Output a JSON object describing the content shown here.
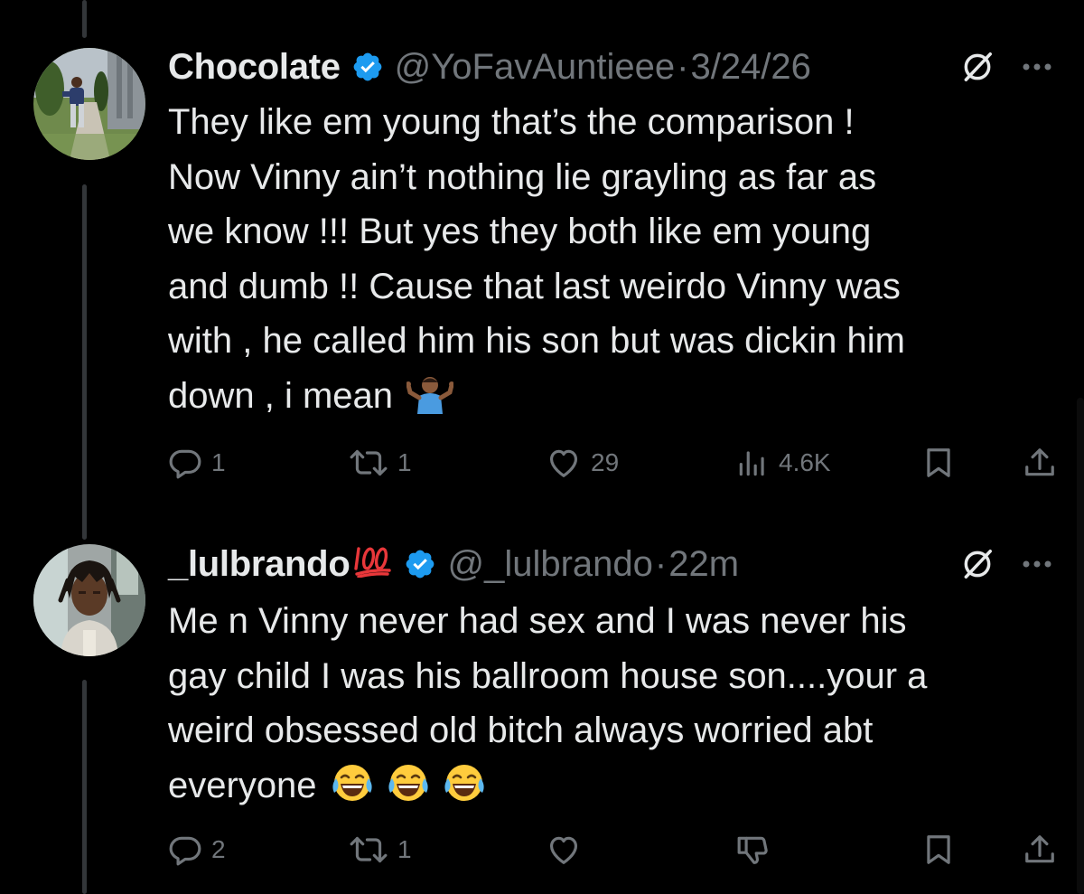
{
  "colors": {
    "background": "#000000",
    "text": "#e7e9ea",
    "muted": "#71767b",
    "verified": "#1d9bf0",
    "thread_line": "#333639"
  },
  "tweets": [
    {
      "display_name": "Chocolate",
      "handle": "@YoFavAuntieee",
      "separator": "·",
      "time": "3/24/26",
      "verified": true,
      "avatar_icon": "avatar-person-outdoors",
      "lines": [
        "They like em young that’s the comparison !",
        "Now Vinny ain’t nothing lie grayling as far as",
        "we know !!! But yes they both like em young",
        "and dumb !! Cause that last weirdo Vinny was",
        "with , he called him his son but was dickin him",
        "down , i mean"
      ],
      "trailing_emoji": "🤷🏾‍♂️",
      "stats": {
        "replies": "1",
        "reposts": "1",
        "likes": "29",
        "views": "4.6K"
      }
    },
    {
      "display_name": "_lulbrando",
      "name_emoji": "💯",
      "handle": "@_lulbrando",
      "separator": "·",
      "time": "22m",
      "verified": true,
      "avatar_icon": "avatar-person-dreadlocks",
      "lines": [
        "Me n Vinny never had sex and I was never his",
        "gay child I was his ballroom house son....your a",
        "weird obsessed old bitch always worried abt",
        "everyone"
      ],
      "trailing_emoji": "😂😂😂",
      "stats": {
        "replies": "2",
        "reposts": "1",
        "likes": "",
        "views": ""
      }
    }
  ],
  "icons": [
    "reply-icon",
    "repost-icon",
    "like-icon",
    "views-icon",
    "bookmark-icon",
    "share-icon",
    "grok-icon",
    "more-icon",
    "verified-icon",
    "dislike-icon"
  ]
}
